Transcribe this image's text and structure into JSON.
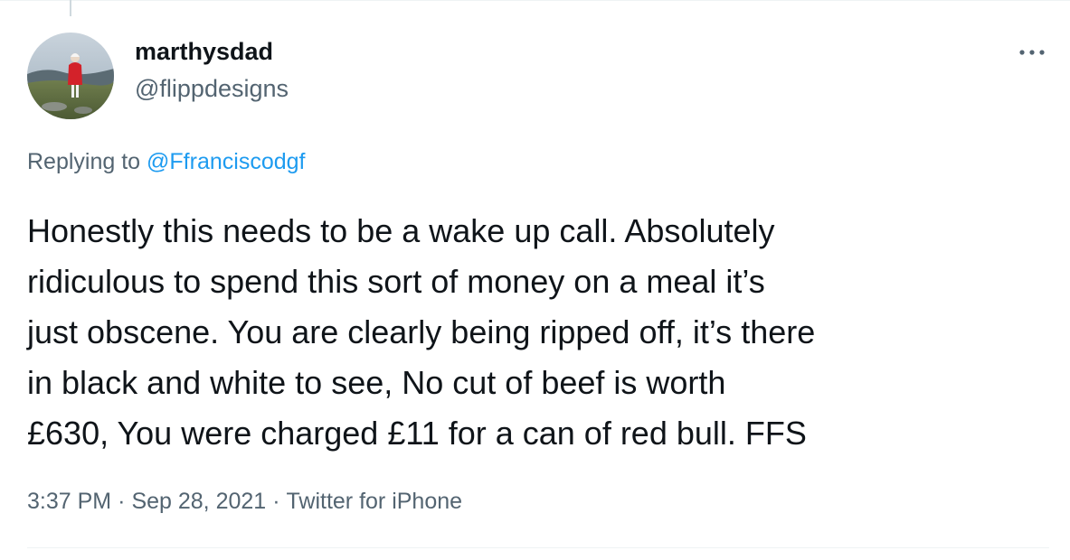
{
  "author": {
    "display_name": "marthysdad",
    "handle": "@flippdesigns",
    "avatar_icon": "user-avatar-photo"
  },
  "menu": {
    "icon": "more-options-icon",
    "glyph": "···"
  },
  "reply": {
    "prefix": "Replying to",
    "mention": "@Ffranciscodgf",
    "mention_color": "#1d9bf0"
  },
  "tweet": {
    "lines": [
      "Honestly this needs to be a wake up call. Absolutely",
      "ridiculous to spend this sort of money on a meal it’s",
      "just obscene. You are clearly being ripped off, it’s there",
      "in black and white to see, No cut of beef is worth",
      "£630, You were charged £11 for a can of red bull. FFS"
    ]
  },
  "meta": {
    "time": "3:37 PM",
    "date": "Sep 28, 2021",
    "source": "Twitter for iPhone",
    "separator": "·"
  },
  "colors": {
    "text": "#0f1419",
    "secondary": "#536471",
    "accent": "#1d9bf0",
    "divider": "#eff3f4"
  }
}
